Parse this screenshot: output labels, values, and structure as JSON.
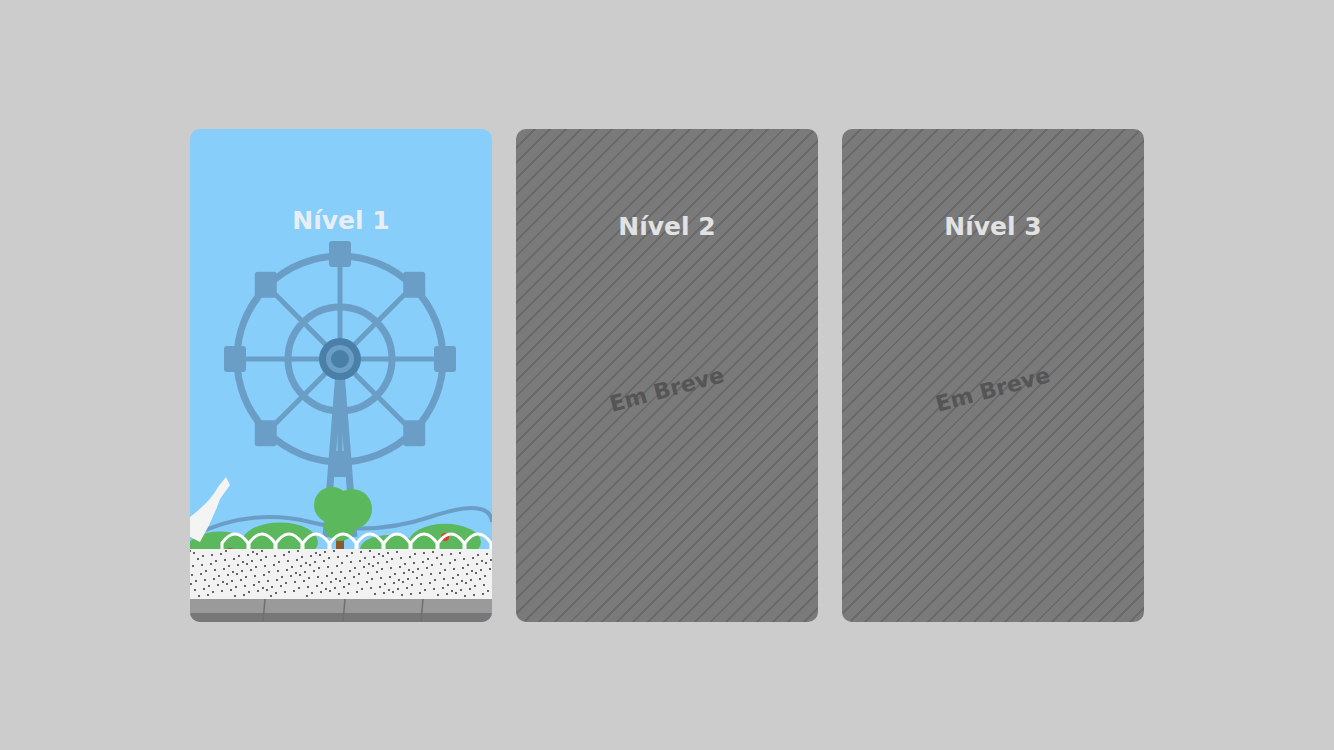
{
  "levels": [
    {
      "title": "Nível 1",
      "locked": false
    },
    {
      "title": "Nível 2",
      "locked": true,
      "badge": "Em Breve"
    },
    {
      "title": "Nível 3",
      "locked": true,
      "badge": "Em Breve"
    }
  ]
}
